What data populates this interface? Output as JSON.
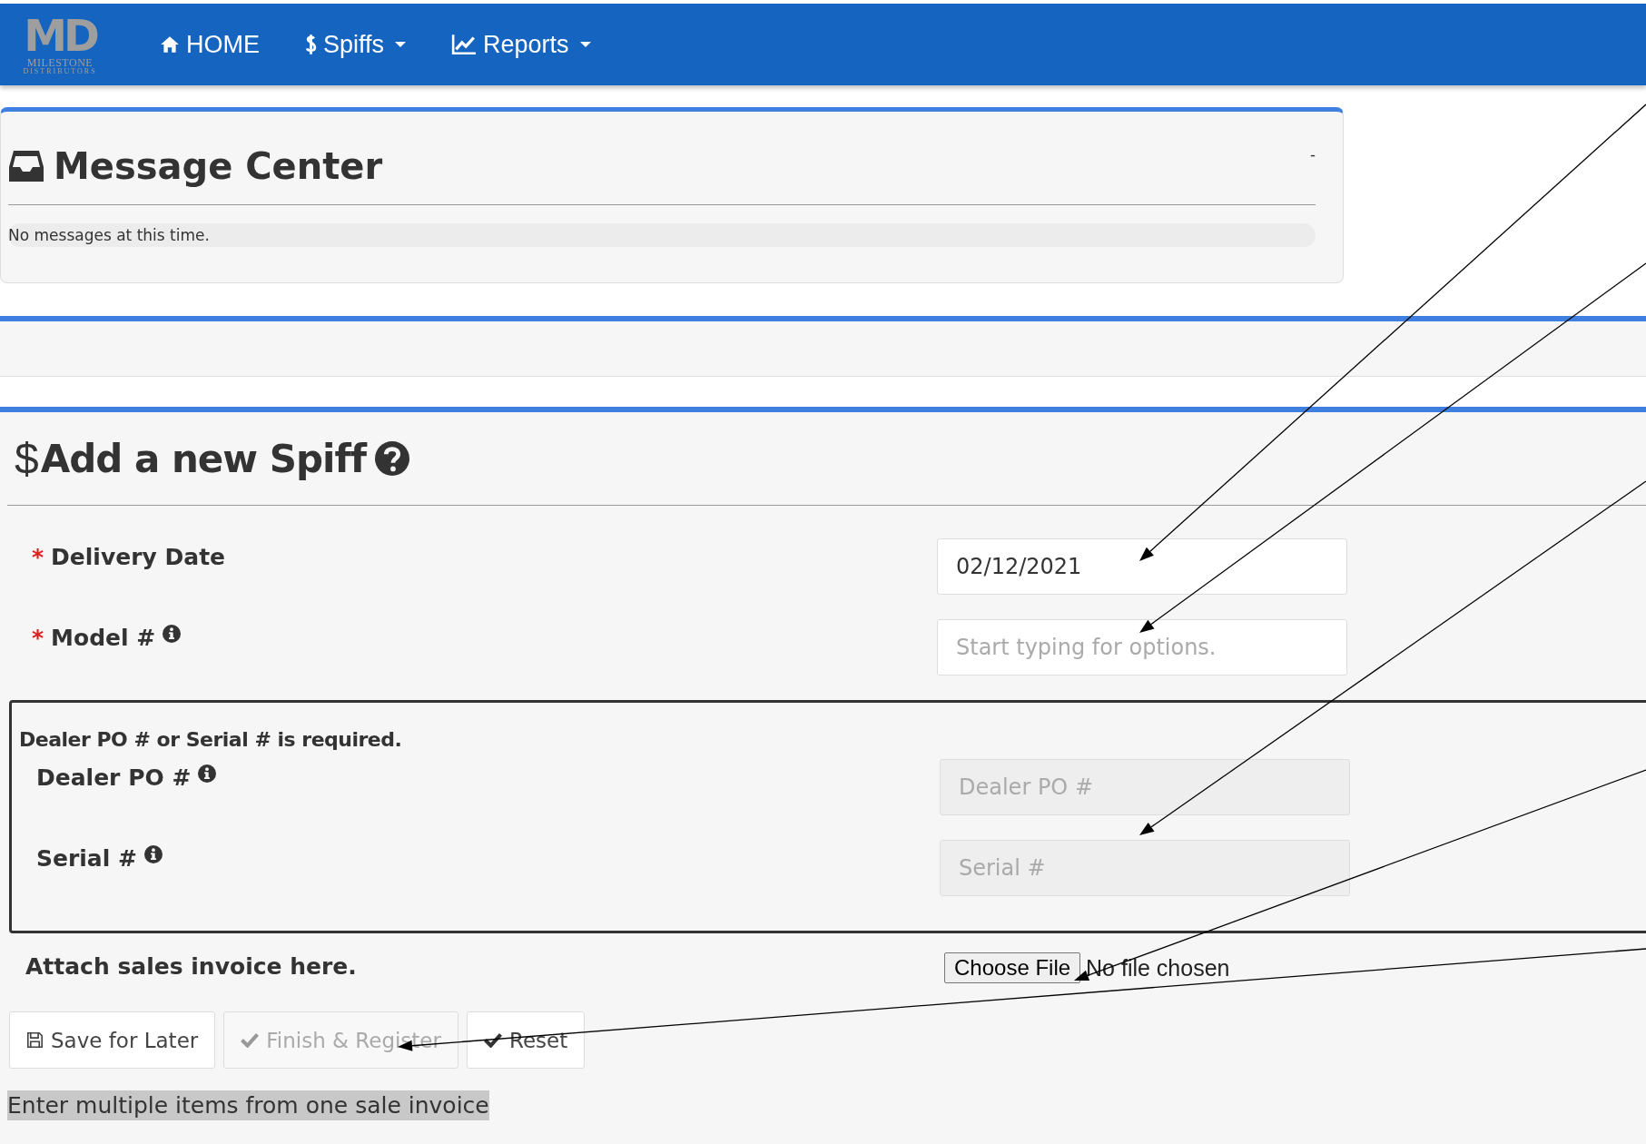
{
  "nav": {
    "logo": {
      "initials": "MD",
      "name": "MILESTONE",
      "sub": "DISTRIBUTORS"
    },
    "items": [
      {
        "label": "HOME",
        "dropdown": false
      },
      {
        "label": "Spiffs",
        "dropdown": true
      },
      {
        "label": "Reports",
        "dropdown": true
      }
    ]
  },
  "message_center": {
    "title": "Message Center",
    "collapse": "-",
    "message": "No messages at this time."
  },
  "spiff_form": {
    "title_icon": "$",
    "title": "Add a new Spiff",
    "fields": [
      {
        "required_mark": "*",
        "label": "Delivery Date",
        "info": false,
        "value": "02/12/2021",
        "disabled": false
      },
      {
        "required_mark": "*",
        "label": "Model #",
        "info": true,
        "placeholder": "Start typing for options.",
        "disabled": false
      }
    ],
    "group": {
      "note": "Dealer PO # or Serial # is required.",
      "fields": [
        {
          "label": "Dealer PO #",
          "info": true,
          "placeholder": "Dealer PO #",
          "disabled": true
        },
        {
          "label": "Serial #",
          "info": true,
          "placeholder": "Serial #",
          "disabled": true
        }
      ]
    },
    "attachment": {
      "label": "Attach sales invoice here.",
      "button": "Choose File",
      "status": "No file chosen"
    },
    "buttons": [
      {
        "label": "Save for Later",
        "disabled": false
      },
      {
        "label": "Finish & Register",
        "disabled": true
      },
      {
        "label": "Reset",
        "disabled": false
      }
    ],
    "footer_note": "Enter multiple items from one sale invoice"
  }
}
